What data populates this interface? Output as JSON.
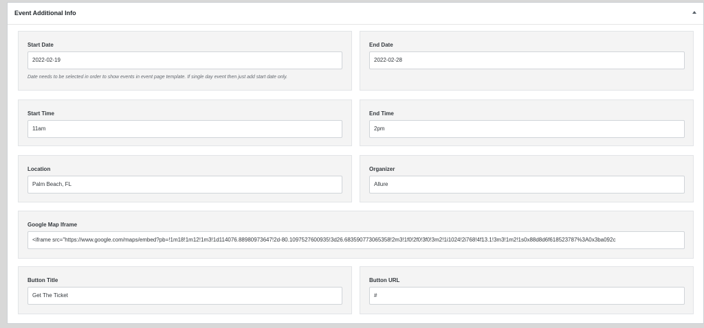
{
  "metabox": {
    "title": "Event Additional Info"
  },
  "fields": {
    "start_date": {
      "label": "Start Date",
      "value": "2022-02-19",
      "hint": "Date needs to be selected in order to show events in event page template. If single day event then just add start date only."
    },
    "end_date": {
      "label": "End Date",
      "value": "2022-02-28"
    },
    "start_time": {
      "label": "Start Time",
      "value": "11am"
    },
    "end_time": {
      "label": "End Time",
      "value": "2pm"
    },
    "location": {
      "label": "Location",
      "value": "Palm Beach, FL"
    },
    "organizer": {
      "label": "Organizer",
      "value": "Allure"
    },
    "google_map_iframe": {
      "label": "Google Map Iframe",
      "value": "<iframe src=\"https://www.google.com/maps/embed?pb=!1m18!1m12!1m3!1d114076.88980973647!2d-80.1097527600935!3d26.683590773065358!2m3!1f0!2f0!3f0!3m2!1i1024!2i768!4f13.1!3m3!1m2!1s0x88d8d6f618523787%3A0x3ba092c"
    },
    "button_title": {
      "label": "Button Title",
      "value": "Get The Ticket"
    },
    "button_url": {
      "label": "Button URL",
      "value": "#"
    }
  }
}
